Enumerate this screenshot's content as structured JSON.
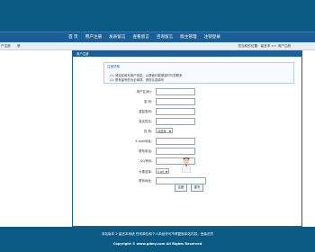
{
  "nav": {
    "items": [
      "首 页",
      "用户注册",
      "发表留言",
      "查看留言",
      "咨询留言",
      "版主管理",
      "注销登录"
    ]
  },
  "breadcrumb": {
    "left": "户注册",
    "left_sub": "册",
    "right": "您当前的位置：留言本 >> 用户注册"
  },
  "panel": {
    "title": "用户注册",
    "notice_heading": "注册须知",
    "notice_1": "(1) 请如实填写用户信息，以便我们能够及时与您联系",
    "notice_2": "(2) 带有星号的为必填项，请您认真填写"
  },
  "form": {
    "username_label": "用户名(帐):",
    "password_label": "密 码:",
    "confirm_label": "重复密码:",
    "realname_label": "真实姓名:",
    "gender_label": "性 别:",
    "gender_value": "请选择",
    "email_label": "E-mail地址:",
    "phone_label": "联系电话:",
    "qq_label": "QQ号码:",
    "avatar_label": "头像选择:",
    "avatar_value": "0.gif",
    "address_label": "联系地址:",
    "submit_label": "注册",
    "reset_label": "重写"
  },
  "footer": {
    "line1": "本站版本 2  留言本系统  任何单位和个人未经许可不得复制本站内容，违者必究",
    "line2": "Copyright © www.gdmy.com All Rights Reserved"
  }
}
